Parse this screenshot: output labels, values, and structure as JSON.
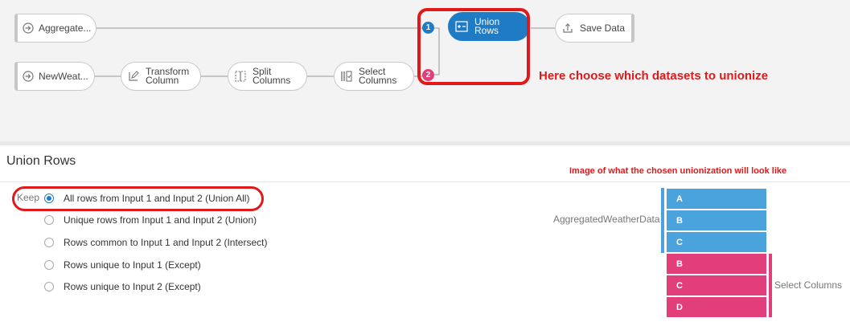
{
  "flow": {
    "nodes": {
      "aggregate": {
        "label": "Aggregate...",
        "icon": "dataset-source-icon"
      },
      "newweather": {
        "label": "NewWeat...",
        "icon": "dataset-source-icon"
      },
      "transform": {
        "label": "Transform\nColumn",
        "icon": "edit-column-icon"
      },
      "split": {
        "label": "Split\nColumns",
        "icon": "split-columns-icon"
      },
      "select": {
        "label": "Select\nColumns",
        "icon": "select-columns-icon"
      },
      "union": {
        "label": "Union\nRows",
        "icon": "union-rows-icon"
      },
      "save": {
        "label": "Save Data",
        "icon": "save-data-icon"
      }
    },
    "input_badges": {
      "first": "1",
      "second": "2"
    },
    "annotation": "Here choose which datasets to unionize"
  },
  "panel": {
    "title": "Union Rows",
    "keep_label": "Keep",
    "options": [
      "All rows from Input 1 and Input 2 (Union All)",
      "Unique rows from Input 1 and Input 2 (Union)",
      "Rows common to Input 1 and Input 2 (Intersect)",
      "Rows unique to Input 1 (Except)",
      "Rows unique to Input 2 (Except)"
    ],
    "selected_index": 0,
    "preview_caption": "Image of what the chosen unionization will look like",
    "preview": {
      "input1_label": "AggregatedWeatherData",
      "input2_label": "Select Columns",
      "input1_rows": [
        "A",
        "B",
        "C"
      ],
      "input2_rows": [
        "B",
        "C",
        "D"
      ]
    }
  },
  "colors": {
    "accent": "#1f7bc4",
    "input1": "#4ba3de",
    "input2": "#e23f7a",
    "highlight": "#e0191b"
  }
}
